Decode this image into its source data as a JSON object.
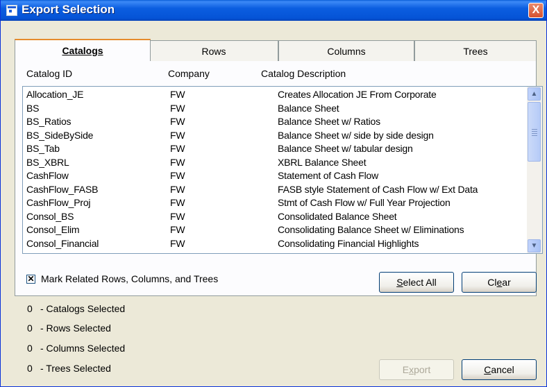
{
  "window": {
    "title": "Export Selection",
    "close_label": "X"
  },
  "tabs": [
    {
      "label": "Catalogs",
      "active": true
    },
    {
      "label": "Rows",
      "active": false
    },
    {
      "label": "Columns",
      "active": false
    },
    {
      "label": "Trees",
      "active": false
    }
  ],
  "columns": {
    "id": "Catalog ID",
    "company": "Company",
    "description": "Catalog Description"
  },
  "rows": [
    {
      "id": "Allocation_JE",
      "company": "FW",
      "description": "Creates Allocation JE From Corporate"
    },
    {
      "id": "BS",
      "company": "FW",
      "description": "Balance Sheet"
    },
    {
      "id": "BS_Ratios",
      "company": "FW",
      "description": "Balance Sheet w/ Ratios"
    },
    {
      "id": "BS_SideBySide",
      "company": "FW",
      "description": "Balance Sheet w/ side by side design"
    },
    {
      "id": "BS_Tab",
      "company": "FW",
      "description": "Balance Sheet w/ tabular design"
    },
    {
      "id": "BS_XBRL",
      "company": "FW",
      "description": "XBRL Balance Sheet"
    },
    {
      "id": "CashFlow",
      "company": "FW",
      "description": "Statement of Cash Flow"
    },
    {
      "id": "CashFlow_FASB",
      "company": "FW",
      "description": "FASB style Statement of Cash Flow w/ Ext Data"
    },
    {
      "id": "CashFlow_Proj",
      "company": "FW",
      "description": "Stmt of Cash Flow w/ Full Year Projection"
    },
    {
      "id": "Consol_BS",
      "company": "FW",
      "description": "Consolidated Balance Sheet"
    },
    {
      "id": "Consol_Elim",
      "company": "FW",
      "description": "Consolidating Balance Sheet w/ Eliminations"
    },
    {
      "id": "Consol_Financial",
      "company": "FW",
      "description": "Consolidating Financial Highlights"
    }
  ],
  "mark_related": {
    "label": "Mark Related Rows, Columns, and Trees",
    "checked": true
  },
  "buttons": {
    "select_all_pre": "",
    "select_all_ul": "S",
    "select_all_post": "elect All",
    "clear_pre": "Cl",
    "clear_ul": "e",
    "clear_post": "ar",
    "export_pre": "E",
    "export_ul": "x",
    "export_post": "port",
    "cancel_pre": "",
    "cancel_ul": "C",
    "cancel_post": "ancel"
  },
  "status": [
    {
      "count": "0",
      "label": "- Catalogs Selected"
    },
    {
      "count": "0",
      "label": "- Rows Selected"
    },
    {
      "count": "0",
      "label": "- Columns Selected"
    },
    {
      "count": "0",
      "label": "- Trees Selected"
    }
  ],
  "icons": {
    "window": "window-icon",
    "close": "close-icon",
    "scroll_up": "arrow-up-icon",
    "scroll_down": "arrow-down-icon"
  }
}
